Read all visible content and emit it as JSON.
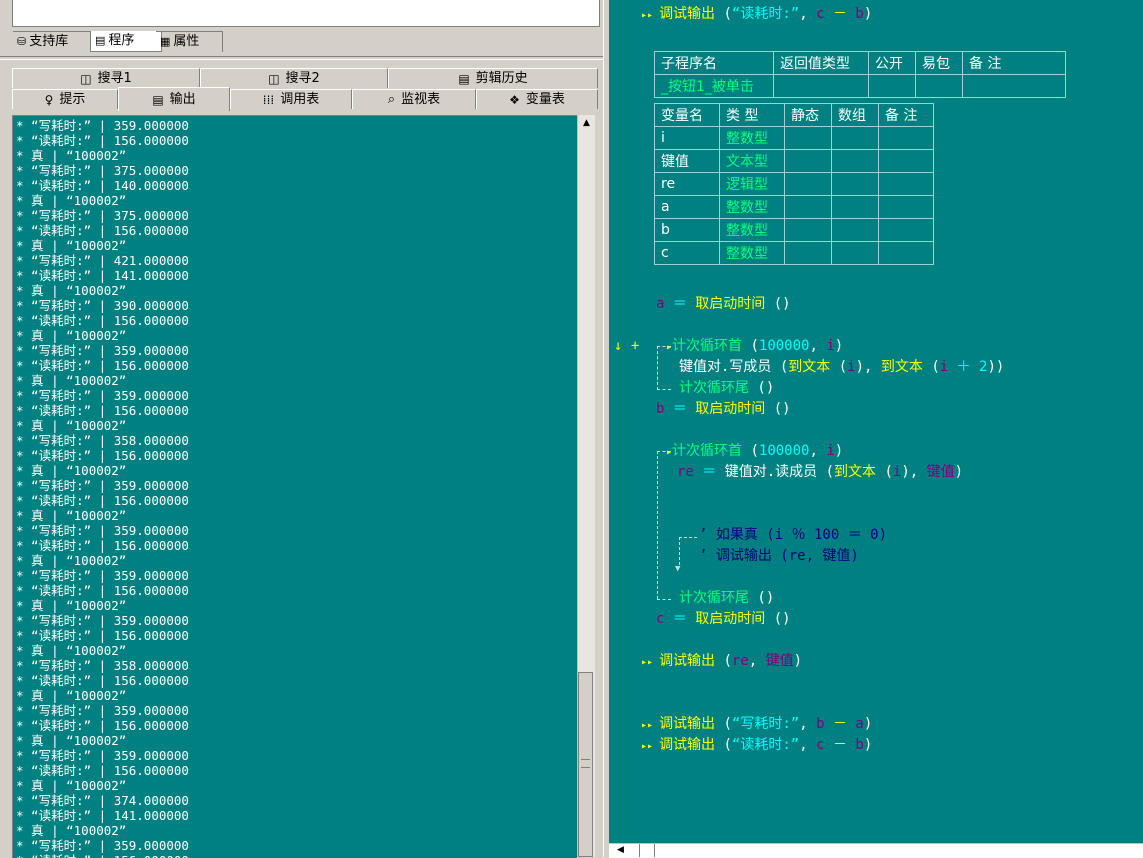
{
  "left_tabs_top": [
    {
      "label": "支持库",
      "icon": "support-lib-icon"
    },
    {
      "label": "程序",
      "icon": "program-icon"
    },
    {
      "label": "属性",
      "icon": "properties-icon"
    }
  ],
  "panel_tabs_row1": [
    {
      "label": "搜寻1",
      "icon": "search-icon"
    },
    {
      "label": "搜寻2",
      "icon": "search-icon"
    },
    {
      "label": "剪辑历史",
      "icon": "clipboard-icon"
    }
  ],
  "panel_tabs_row2": [
    {
      "label": "提示",
      "icon": "hint-icon"
    },
    {
      "label": "输出",
      "icon": "output-icon"
    },
    {
      "label": "调用表",
      "icon": "call-table-icon"
    },
    {
      "label": "监视表",
      "icon": "watch-icon"
    },
    {
      "label": "变量表",
      "icon": "variable-icon"
    }
  ],
  "output_lines": [
    "* “写耗时:” | 359.000000",
    "* “读耗时:” | 156.000000",
    "* 真 | “100002”",
    "* “写耗时:” | 375.000000",
    "* “读耗时:” | 140.000000",
    "* 真 | “100002”",
    "* “写耗时:” | 375.000000",
    "* “读耗时:” | 156.000000",
    "* 真 | “100002”",
    "* “写耗时:” | 421.000000",
    "* “读耗时:” | 141.000000",
    "* 真 | “100002”",
    "* “写耗时:” | 390.000000",
    "* “读耗时:” | 156.000000",
    "* 真 | “100002”",
    "* “写耗时:” | 359.000000",
    "* “读耗时:” | 156.000000",
    "* 真 | “100002”",
    "* “写耗时:” | 359.000000",
    "* “读耗时:” | 156.000000",
    "* 真 | “100002”",
    "* “写耗时:” | 358.000000",
    "* “读耗时:” | 156.000000",
    "* 真 | “100002”",
    "* “写耗时:” | 359.000000",
    "* “读耗时:” | 156.000000",
    "* 真 | “100002”",
    "* “写耗时:” | 359.000000",
    "* “读耗时:” | 156.000000",
    "* 真 | “100002”",
    "* “写耗时:” | 359.000000",
    "* “读耗时:” | 156.000000",
    "* 真 | “100002”",
    "* “写耗时:” | 359.000000",
    "* “读耗时:” | 156.000000",
    "* 真 | “100002”",
    "* “写耗时:” | 358.000000",
    "* “读耗时:” | 156.000000",
    "* 真 | “100002”",
    "* “写耗时:” | 359.000000",
    "* “读耗时:” | 156.000000",
    "* 真 | “100002”",
    "* “写耗时:” | 359.000000",
    "* “读耗时:” | 156.000000",
    "* 真 | “100002”",
    "* “写耗时:” | 374.000000",
    "* “读耗时:” | 141.000000",
    "* 真 | “100002”",
    "* “写耗时:” | 359.000000",
    "* “读耗时:” | 156.000000"
  ],
  "code": {
    "top_debug": {
      "fn": "调试输出",
      "lp": " (",
      "str": "“读耗时:”",
      ", ": ", ",
      "a": "c",
      "op": " － ",
      "b": "b",
      "rp": ")"
    },
    "sub_table": {
      "headers": [
        "子程序名",
        "返回值类型",
        "公开",
        "易包",
        "备 注"
      ],
      "row": [
        "_按钮1_被单击",
        "",
        "",
        "",
        ""
      ]
    },
    "var_table": {
      "headers": [
        "变量名",
        "类 型",
        "静态",
        "数组",
        "备 注"
      ],
      "rows": [
        [
          "i",
          "整数型",
          "",
          "",
          ""
        ],
        [
          "键值",
          "文本型",
          "",
          "",
          ""
        ],
        [
          "re",
          "逻辑型",
          "",
          "",
          ""
        ],
        [
          "a",
          "整数型",
          "",
          "",
          ""
        ],
        [
          "b",
          "整数型",
          "",
          "",
          ""
        ],
        [
          "c",
          "整数型",
          "",
          "",
          ""
        ]
      ]
    },
    "line_a": {
      "var": "a",
      "eq": " ＝ ",
      "fn": "取启动时间",
      "args": " ()"
    },
    "loop1_head": {
      "fn": "计次循环首",
      "lp": " (",
      "n": "100000",
      ", ": ", ",
      "v": "i",
      "rp": ")"
    },
    "loop1_body": {
      "obj": "键值对.写成员",
      "lp": " (",
      "f1": "到文本",
      "a1": " (",
      "v1": "i",
      "c1": "), ",
      "f2": "到文本",
      "a2": " (",
      "v2": "i",
      "op": " ＋ ",
      "n": "2",
      "rp": "))"
    },
    "loop1_tail": {
      "fn": "计次循环尾",
      "args": " ()"
    },
    "line_b": {
      "var": "b",
      "eq": " ＝ ",
      "fn": "取启动时间",
      "args": " ()"
    },
    "loop2_head": {
      "fn": "计次循环首",
      "lp": " (",
      "n": "100000",
      ", ": ", ",
      "v": "i",
      "rp": ")"
    },
    "loop2_body": {
      "var": "re",
      "eq": " ＝ ",
      "obj": "键值对.读成员",
      "lp": " (",
      "f": "到文本",
      "a": " (",
      "v": "i",
      "c": "), ",
      "k": "键值",
      "rp": ")"
    },
    "comment1": "’ 如果真 (i ％ 100 ＝ 0)",
    "comment2": "’ 调试输出 (re, 键值)",
    "loop2_tail": {
      "fn": "计次循环尾",
      "args": " ()"
    },
    "line_c": {
      "var": "c",
      "eq": " ＝ ",
      "fn": "取启动时间",
      "args": " ()"
    },
    "debug_re": {
      "fn": "调试输出",
      "lp": " (",
      "a": "re",
      ", ": ", ",
      "b": "键值",
      "rp": ")"
    },
    "debug_w": {
      "fn": "调试输出",
      "lp": " (",
      "str": "“写耗时:”",
      ", ": ", ",
      "a": "b",
      "op": " － ",
      "b": "a",
      "rp": ")"
    },
    "debug_r": {
      "fn": "调试输出",
      "lp": " (",
      "str": "“读耗时:”",
      ", ": ", ",
      "a": "c",
      "op": " － ",
      "b": "b",
      "rp": ")"
    },
    "gutter_marks": "↓ +"
  }
}
